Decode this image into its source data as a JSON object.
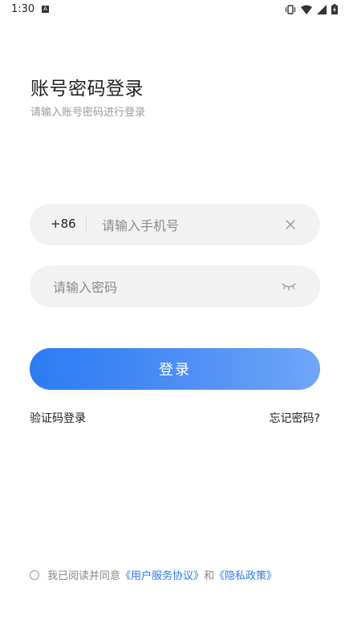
{
  "status_bar": {
    "time": "1:30",
    "notification_badge": "A",
    "icons": [
      "vibrate-icon",
      "wifi-icon",
      "signal-icon",
      "battery-charging-icon"
    ]
  },
  "page": {
    "title": "账号密码登录",
    "subtitle": "请输入账号密码进行登录"
  },
  "form": {
    "country_code": "+86",
    "phone_placeholder": "请输入手机号",
    "phone_value": "",
    "password_placeholder": "请输入密码",
    "password_value": "",
    "clear_icon": "close-icon",
    "visibility_icon": "eye-closed-icon",
    "login_label": "登录"
  },
  "links": {
    "sms_login": "验证码登录",
    "forgot_password": "忘记密码?"
  },
  "agreement": {
    "checked": false,
    "prefix": "我已阅读并同意",
    "user_agreement": "《用户服务协议》",
    "conjunction": "和",
    "privacy_policy": "《隐私政策》"
  },
  "colors": {
    "accent": "#2a7bf3",
    "field_bg": "#f2f2f2"
  }
}
